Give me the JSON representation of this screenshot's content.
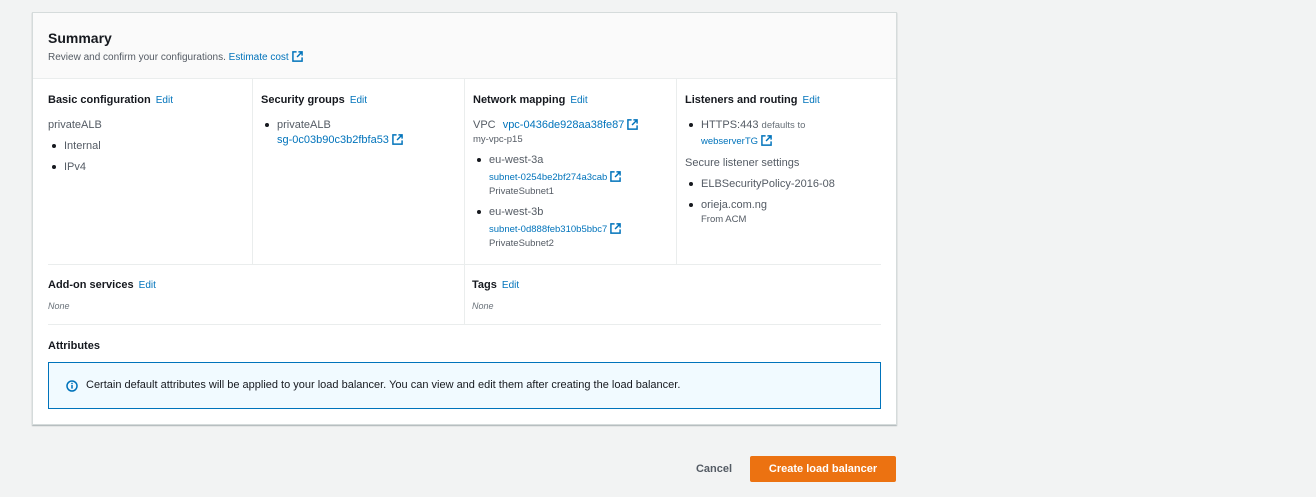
{
  "summary": {
    "title": "Summary",
    "description": "Review and confirm your configurations.",
    "estimate_cost_link": "Estimate cost"
  },
  "edit_label": "Edit",
  "basic_config": {
    "title": "Basic configuration",
    "name": "privateALB",
    "items": [
      "Internal",
      "IPv4"
    ]
  },
  "security_groups": {
    "title": "Security groups",
    "name": "privateALB",
    "sg_id": "sg-0c03b90c3b2fbfa53"
  },
  "network_mapping": {
    "title": "Network mapping",
    "vpc_label": "VPC",
    "vpc_id": "vpc-0436de928aa38fe87",
    "vpc_name": "my-vpc-p15",
    "zones": [
      {
        "az": "eu-west-3a",
        "subnet_id": "subnet-0254be2bf274a3cab",
        "subnet_name": "PrivateSubnet1"
      },
      {
        "az": "eu-west-3b",
        "subnet_id": "subnet-0d888feb310b5bbc7",
        "subnet_name": "PrivateSubnet2"
      }
    ]
  },
  "listeners": {
    "title": "Listeners and routing",
    "listener": "HTTPS:443",
    "defaults_to": "defaults to",
    "target_group": "webserverTG",
    "secure_settings_title": "Secure listener settings",
    "policy": "ELBSecurityPolicy-2016-08",
    "certificate": "orieja.com.ng",
    "certificate_source": "From ACM"
  },
  "addon_services": {
    "title": "Add-on services",
    "value": "None"
  },
  "tags": {
    "title": "Tags",
    "value": "None"
  },
  "attributes": {
    "title": "Attributes",
    "alert_text": "Certain default attributes will be applied to your load balancer. You can view and edit them after creating the load balancer."
  },
  "actions": {
    "cancel": "Cancel",
    "create": "Create load balancer"
  },
  "colors": {
    "link": "#0073bb",
    "primary_button": "#ec7211",
    "info_border": "#0073bb"
  }
}
